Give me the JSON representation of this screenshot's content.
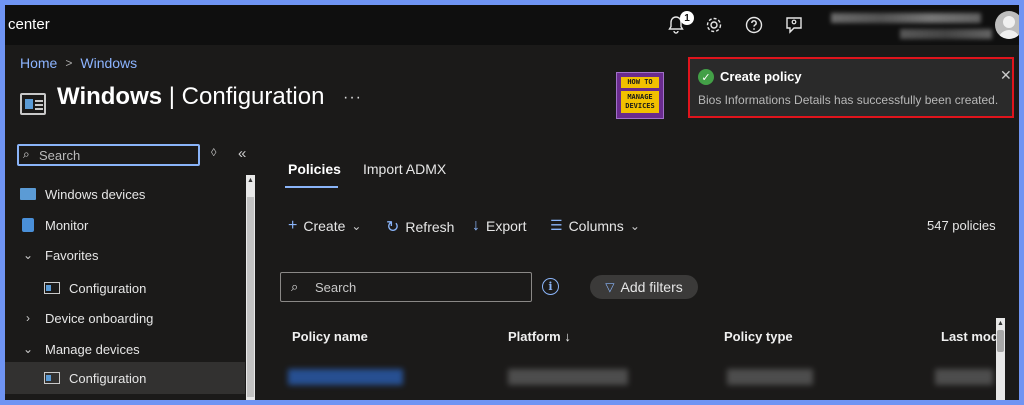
{
  "topbar": {
    "brand": "center",
    "notification_count": "1",
    "icons": [
      "bell-icon",
      "gear-icon",
      "help-icon",
      "feedback-icon"
    ]
  },
  "breadcrumb": [
    "Home",
    "Windows"
  ],
  "page": {
    "title_bold": "Windows",
    "title_rest": " | Configuration",
    "more": "···"
  },
  "logo": {
    "line1": "HOW TO",
    "line2": "MANAGE DEVICES"
  },
  "toast": {
    "title": "Create policy",
    "message": "Bios Informations Details has successfully been created.",
    "close": "✕",
    "border_color": "#e0141c"
  },
  "nav": {
    "search_placeholder": "Search",
    "items": [
      {
        "label": "Windows devices",
        "icon": "windows-devices-icon"
      },
      {
        "label": "Monitor",
        "icon": "monitor-icon"
      },
      {
        "label": "Favorites",
        "icon": "chevron-down-icon"
      },
      {
        "label": "Configuration",
        "icon": "configuration-icon"
      },
      {
        "label": "Device onboarding",
        "icon": "chevron-right-icon"
      },
      {
        "label": "Manage devices",
        "icon": "chevron-down-icon"
      },
      {
        "label": "Configuration",
        "icon": "configuration-icon"
      }
    ]
  },
  "tabs": [
    "Policies",
    "Import ADMX"
  ],
  "toolbar": {
    "create": "Create",
    "refresh": "Refresh",
    "export": "Export",
    "columns": "Columns"
  },
  "policy_count": "547 policies",
  "search_placeholder": "Search",
  "add_filters": "Add filters",
  "table": {
    "columns": [
      "Policy name",
      "Platform ↓",
      "Policy type",
      "Last mod"
    ]
  },
  "accent_color": "#8ab4f8"
}
